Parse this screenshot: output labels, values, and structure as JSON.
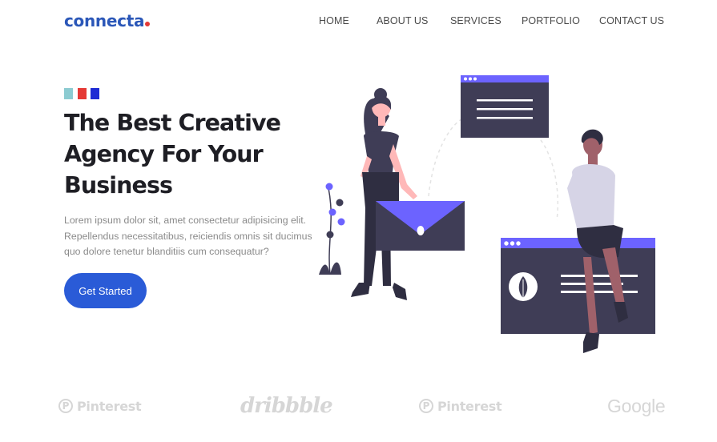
{
  "brand": {
    "name": "connecta",
    "accent": "#2b57b8",
    "dot_color": "#e53935"
  },
  "nav": {
    "items": [
      {
        "label": "HOME"
      },
      {
        "label": "ABOUT US"
      },
      {
        "label": "SERVICES"
      },
      {
        "label": "PORTFOLIO"
      },
      {
        "label": "CONTACT US"
      }
    ]
  },
  "hero": {
    "swatches": [
      "#8ccbd1",
      "#e53935",
      "#1e2bd4"
    ],
    "title_lines": [
      "The Best Creative",
      "Agency For Your",
      "Business"
    ],
    "description_lines": [
      "Lorem ipsum dolor sit, amet consectetur adipisicing elit.",
      "Repellendus necessitatibus, reiciendis omnis sit ducimus",
      "quo dolore tenetur blanditiis cum consequatur?"
    ],
    "cta_label": "Get Started",
    "cta_color": "#2a5bd7",
    "illustration_colors": {
      "primary": "#6c63ff",
      "dark": "#3f3d56",
      "skin": "#a0616a",
      "shirt": "#d6d4e6"
    }
  },
  "partners": [
    {
      "name": "Pinterest",
      "icon": "pinterest-icon",
      "icon_glyph": "P"
    },
    {
      "name": "dribbble",
      "icon": "dribbble-logo"
    },
    {
      "name": "Pinterest",
      "icon": "pinterest-icon",
      "icon_glyph": "P"
    },
    {
      "name": "Google",
      "icon": "google-logo"
    }
  ]
}
